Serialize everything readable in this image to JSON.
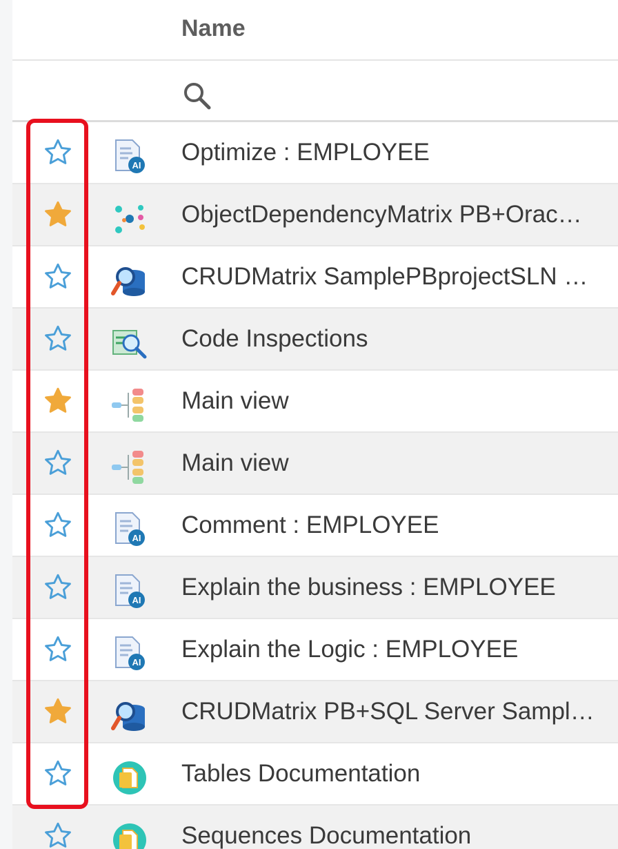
{
  "header": {
    "name_label": "Name"
  },
  "filter": {
    "icon": "search-icon"
  },
  "colors": {
    "star_filled": "#f0a93a",
    "star_outline": "#4a9fd8",
    "highlight": "#e8101e"
  },
  "rows": [
    {
      "label": "Optimize : EMPLOYEE",
      "favorite": false,
      "icon": "document-ai-icon"
    },
    {
      "label": "ObjectDependencyMatrix PB+Orac…",
      "favorite": true,
      "icon": "dependency-graph-icon"
    },
    {
      "label": "CRUDMatrix SamplePBprojectSLN …",
      "favorite": false,
      "icon": "database-search-icon"
    },
    {
      "label": "Code Inspections",
      "favorite": false,
      "icon": "code-inspection-icon"
    },
    {
      "label": "Main view",
      "favorite": true,
      "icon": "tree-view-icon"
    },
    {
      "label": "Main view",
      "favorite": false,
      "icon": "tree-view-icon"
    },
    {
      "label": "Comment : EMPLOYEE",
      "favorite": false,
      "icon": "document-ai-icon"
    },
    {
      "label": "Explain the business : EMPLOYEE",
      "favorite": false,
      "icon": "document-ai-icon"
    },
    {
      "label": "Explain the Logic : EMPLOYEE",
      "favorite": false,
      "icon": "document-ai-icon"
    },
    {
      "label": "CRUDMatrix PB+SQL Server Sampl…",
      "favorite": true,
      "icon": "database-search-icon"
    },
    {
      "label": "Tables Documentation",
      "favorite": false,
      "icon": "documentation-icon"
    },
    {
      "label": "Sequences Documentation",
      "favorite": false,
      "icon": "documentation-icon"
    }
  ]
}
